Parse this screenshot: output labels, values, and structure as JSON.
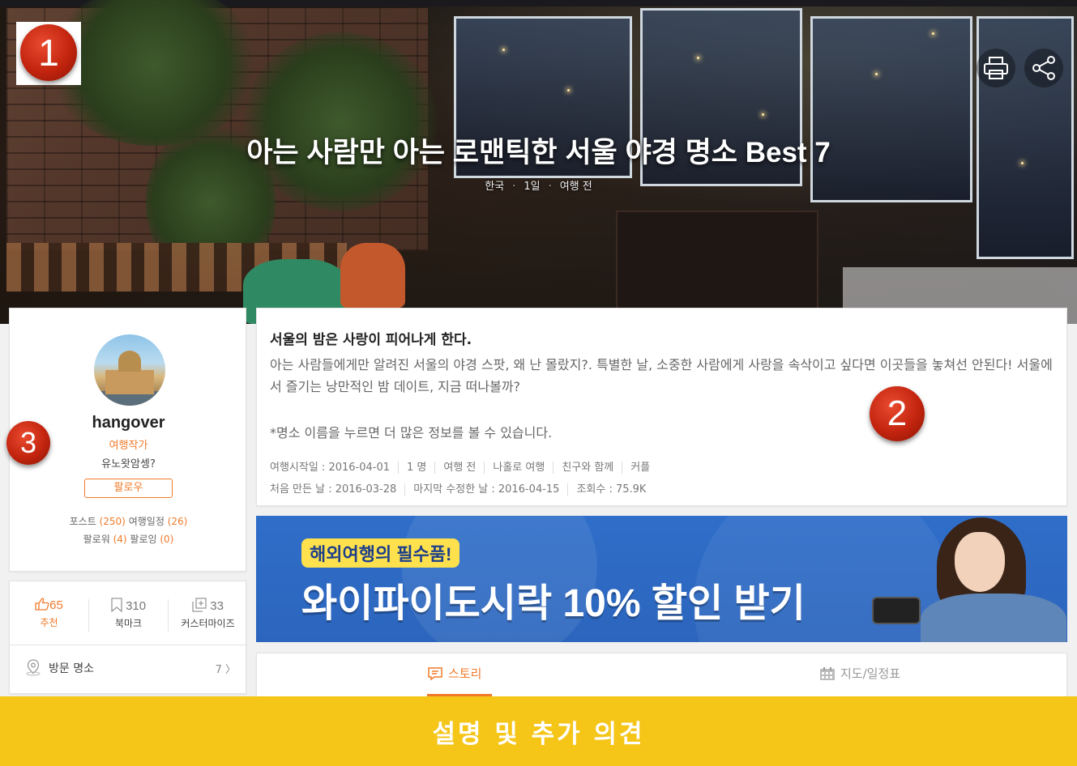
{
  "hero": {
    "title": "아는 사람만 아는 로맨틱한 서울 야경 명소 Best 7",
    "meta": [
      "한국",
      "1일",
      "여행 전"
    ],
    "print_icon": "print-icon",
    "share_icon": "share-icon"
  },
  "markers": [
    "1",
    "2",
    "3"
  ],
  "profile": {
    "name": "hangover",
    "role": "여행작가",
    "bio": "유노왓암셍?",
    "follow_label": "팔로우",
    "posts_label": "포스트",
    "posts_count": "(250)",
    "plans_label": "여행일정",
    "plans_count": "(26)",
    "followers_label": "팔로워",
    "followers_count": "(4)",
    "following_label": "팔로잉",
    "following_count": "(0)"
  },
  "actions": {
    "like_count": "65",
    "like_label": "추천",
    "bookmark_count": "310",
    "bookmark_label": "북마크",
    "customize_count": "33",
    "customize_label": "커스터마이즈",
    "visit_label": "방문 명소",
    "visit_count": "7 〉"
  },
  "description": {
    "title": "서울의 밤은 사랑이 피어나게 한다.",
    "body": "아는 사람들에게만 알려진 서울의 야경 스팟, 왜 난 몰랐지?. 특별한 날, 소중한 사람에게 사랑을 속삭이고 싶다면 이곳들을 놓쳐선 안된다! 서울에서 즐기는 낭만적인 밤 데이트, 지금 떠나볼까?",
    "note": "*명소 이름을 누르면 더 많은 정보를 볼 수 있습니다.",
    "meta_row1": [
      "여행시작일 : 2016-04-01",
      "1 명",
      "여행 전",
      "나홀로 여행",
      "친구와 함께",
      "커플"
    ],
    "meta_row2": [
      "처음 만든 날 : 2016-03-28",
      "마지막 수정한 날 : 2016-04-15",
      "조회수 : 75.9K"
    ]
  },
  "banner": {
    "tag": "해외여행의 필수품!",
    "headline": "와이파이도시락 10% 할인 받기"
  },
  "tabs": {
    "story": "스토리",
    "map": "지도/일정표"
  },
  "footer": {
    "label": "설명 및 추가 의견"
  },
  "colors": {
    "accent": "#f07a2a",
    "footer": "#f5c518",
    "banner": "#2f6ec9"
  }
}
